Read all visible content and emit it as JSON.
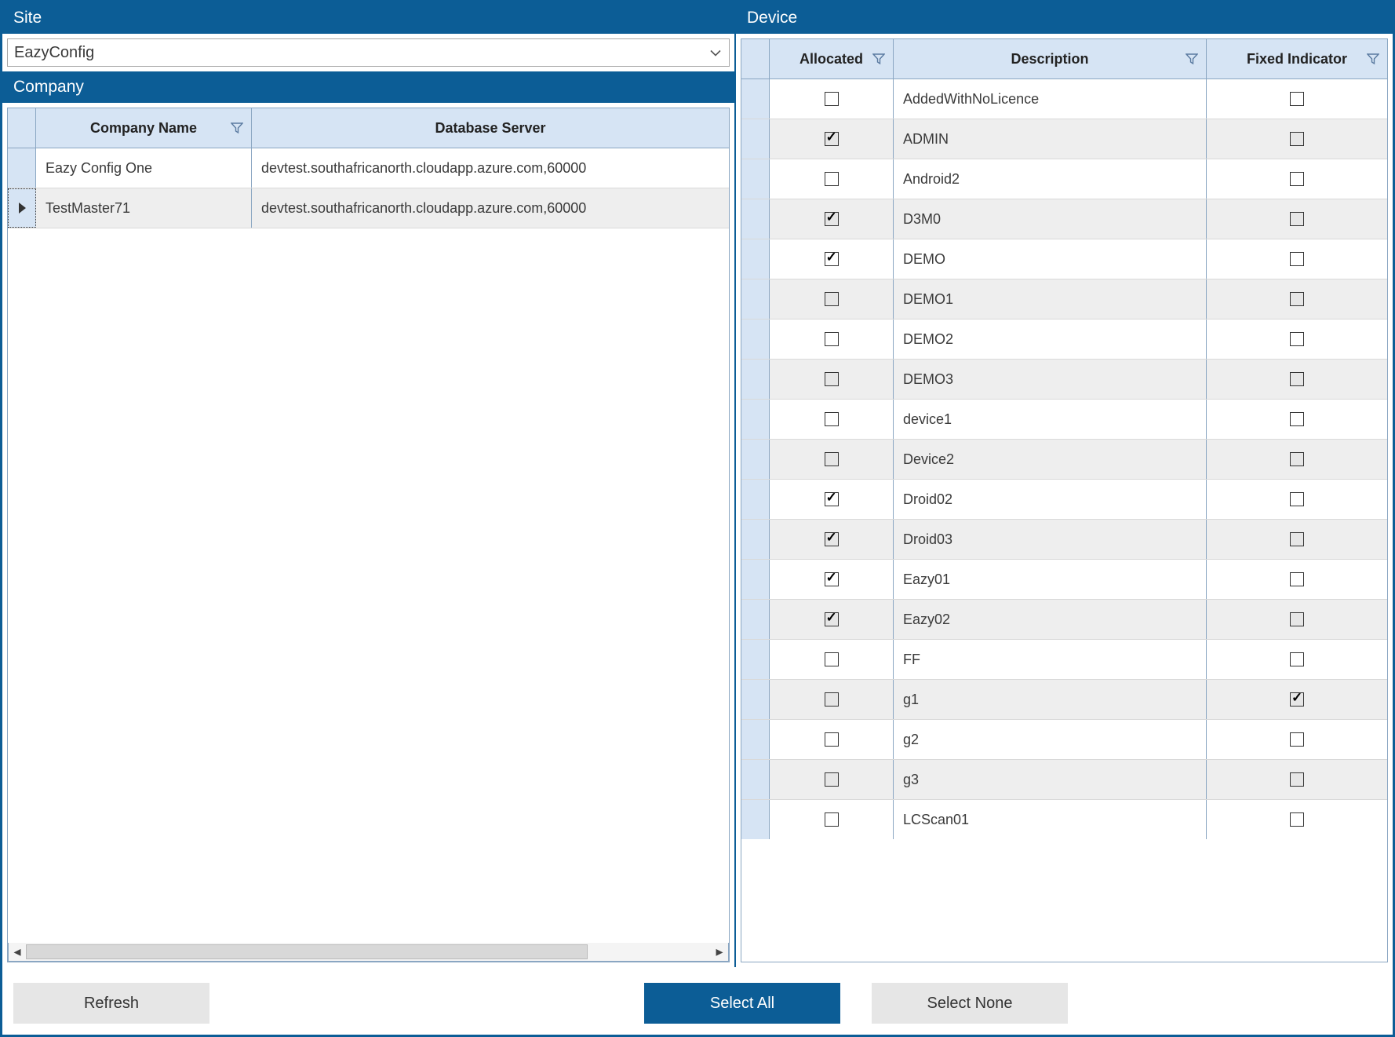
{
  "site": {
    "header": "Site",
    "selected": "EazyConfig"
  },
  "company": {
    "header": "Company",
    "columns": {
      "name": "Company Name",
      "db": "Database Server"
    },
    "rows": [
      {
        "name": "Eazy Config One",
        "db": "devtest.southafricanorth.cloudapp.azure.com,60000",
        "selected": false
      },
      {
        "name": "TestMaster71",
        "db": "devtest.southafricanorth.cloudapp.azure.com,60000",
        "selected": true
      }
    ]
  },
  "device": {
    "header": "Device",
    "columns": {
      "allocated": "Allocated",
      "description": "Description",
      "fixed": "Fixed Indicator"
    },
    "rows": [
      {
        "allocated": false,
        "description": "AddedWithNoLicence",
        "fixed": false
      },
      {
        "allocated": true,
        "description": "ADMIN",
        "fixed": false
      },
      {
        "allocated": false,
        "description": "Android2",
        "fixed": false
      },
      {
        "allocated": true,
        "description": "D3M0",
        "fixed": false
      },
      {
        "allocated": true,
        "description": "DEMO",
        "fixed": false
      },
      {
        "allocated": false,
        "description": "DEMO1",
        "fixed": false
      },
      {
        "allocated": false,
        "description": "DEMO2",
        "fixed": false
      },
      {
        "allocated": false,
        "description": "DEMO3",
        "fixed": false
      },
      {
        "allocated": false,
        "description": "device1",
        "fixed": false
      },
      {
        "allocated": false,
        "description": "Device2",
        "fixed": false
      },
      {
        "allocated": true,
        "description": "Droid02",
        "fixed": false
      },
      {
        "allocated": true,
        "description": "Droid03",
        "fixed": false
      },
      {
        "allocated": true,
        "description": "Eazy01",
        "fixed": false
      },
      {
        "allocated": true,
        "description": "Eazy02",
        "fixed": false
      },
      {
        "allocated": false,
        "description": "FF",
        "fixed": false
      },
      {
        "allocated": false,
        "description": "g1",
        "fixed": true
      },
      {
        "allocated": false,
        "description": "g2",
        "fixed": false
      },
      {
        "allocated": false,
        "description": "g3",
        "fixed": false
      },
      {
        "allocated": false,
        "description": "LCScan01",
        "fixed": false
      }
    ]
  },
  "buttons": {
    "refresh": "Refresh",
    "selectAll": "Select All",
    "selectNone": "Select None"
  }
}
